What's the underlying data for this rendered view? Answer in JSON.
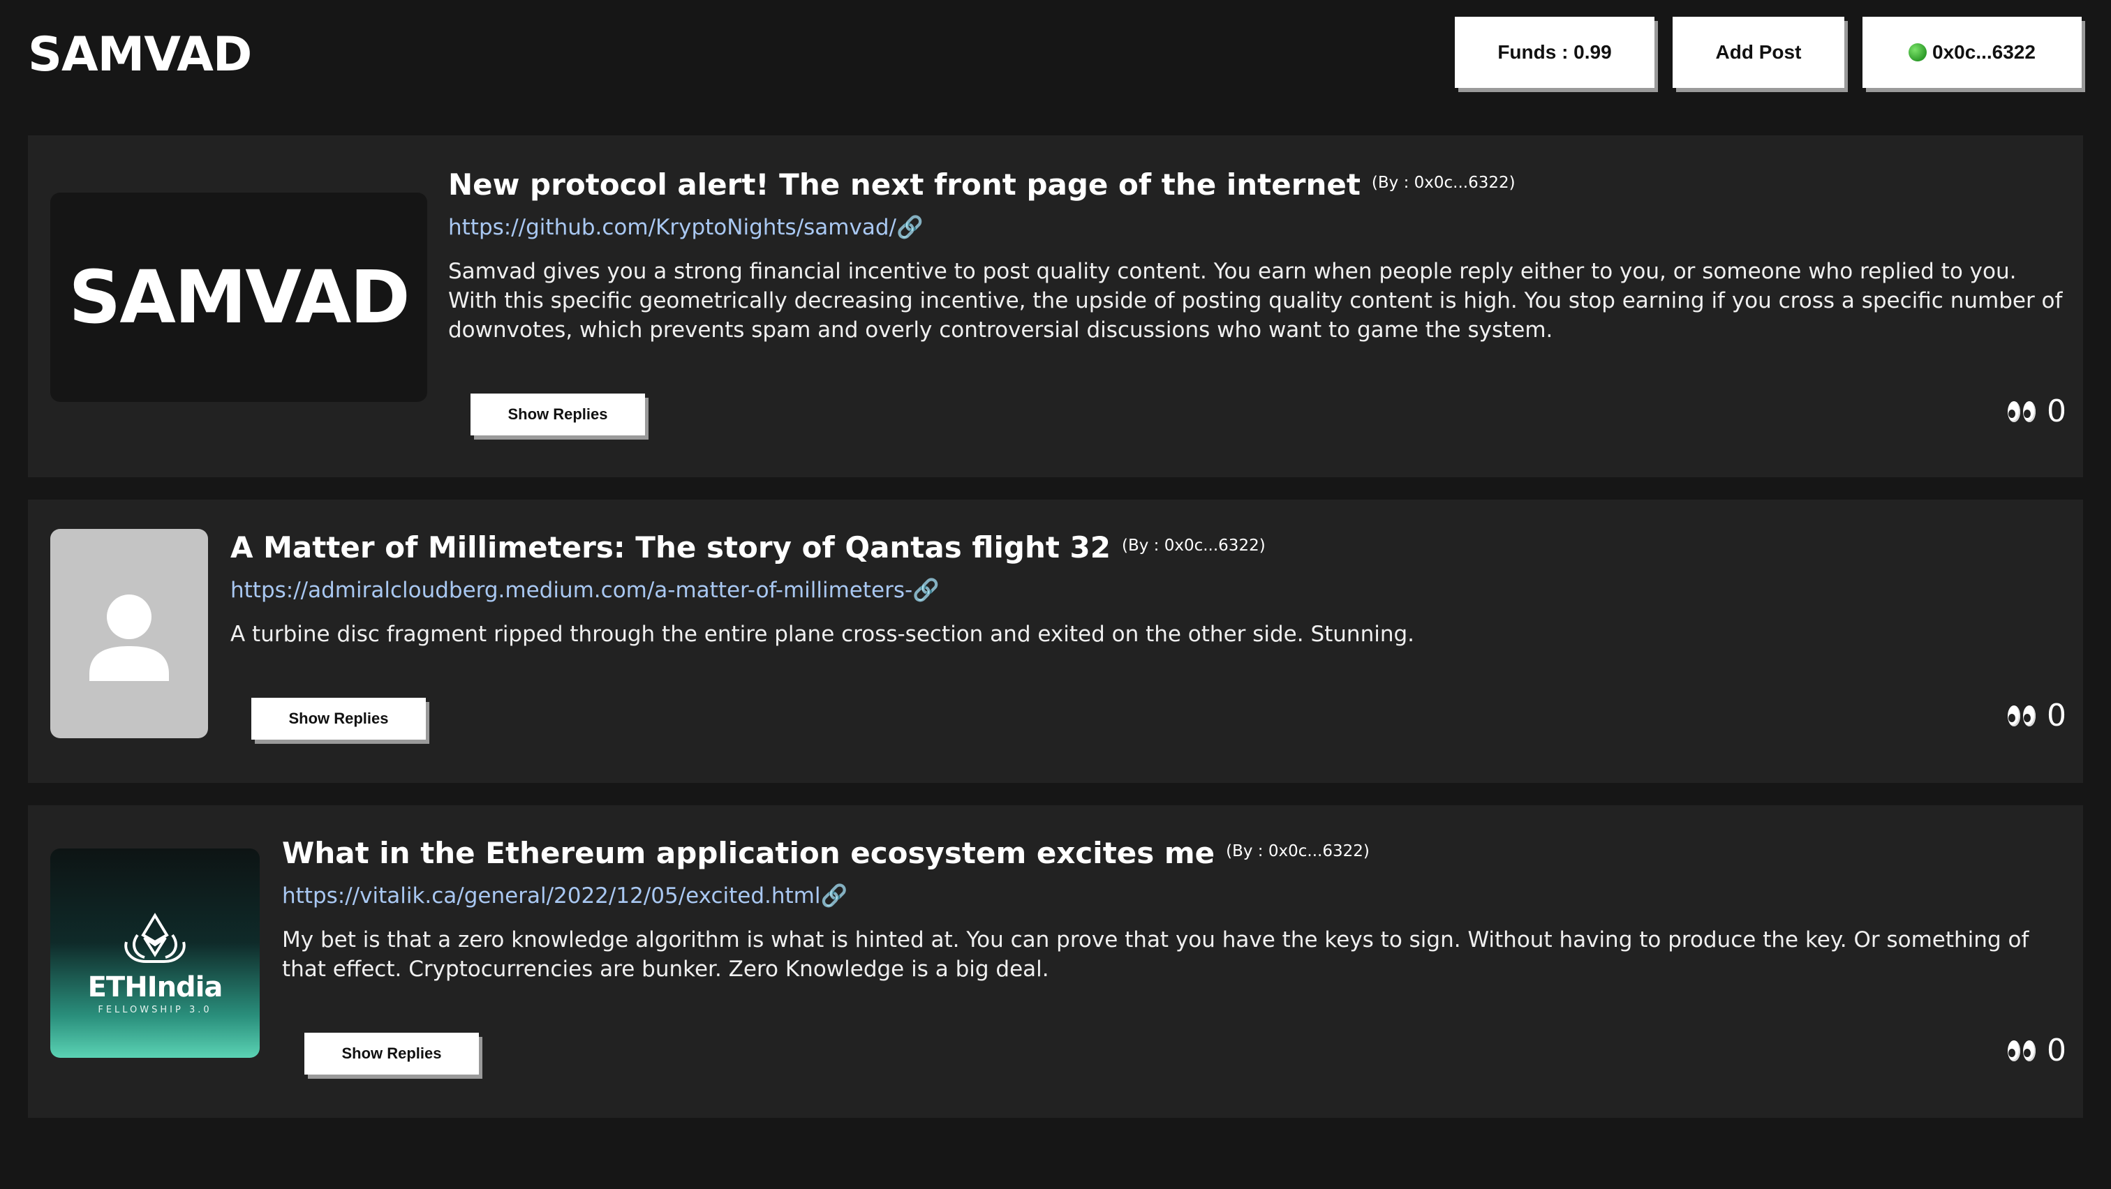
{
  "app": {
    "logo": "SAMVAD"
  },
  "header": {
    "funds_label": "Funds : 0.99",
    "add_post_label": "Add Post",
    "wallet_label": "0x0c...6322",
    "wallet_status_color": "#2e9c2a"
  },
  "posts": [
    {
      "title": "New protocol alert! The next front page of the internet",
      "author": "(By : 0x0c...6322)",
      "link": "https://github.com/KryptoNights/samvad/🔗",
      "body": "Samvad gives you a strong financial incentive to post quality content. You earn when people reply either to you, or someone who replied to you. With this specific geometrically decreasing incentive, the upside of posting quality content is high. You stop earning if you cross a specific number of downvotes, which prevents spam and overly controversial discussions who want to game the system.",
      "thumbnail_text": "SAMVAD",
      "replies_label": "Show Replies",
      "views": "0"
    },
    {
      "title": "A Matter of Millimeters: The story of Qantas flight 32",
      "author": "(By : 0x0c...6322)",
      "link": "https://admiralcloudberg.medium.com/a-matter-of-millimeters-🔗",
      "body": "A turbine disc fragment ripped through the entire plane cross-section and exited on the other side. Stunning.",
      "thumbnail_icon": "person-placeholder-icon",
      "replies_label": "Show Replies",
      "views": "0"
    },
    {
      "title": "What in the Ethereum application ecosystem excites me",
      "author": "(By : 0x0c...6322)",
      "link": "https://vitalik.ca/general/2022/12/05/excited.html🔗",
      "body": "My bet is that a zero knowledge algorithm is what is hinted at. You can prove that you have the keys to sign. Without having to produce the key. Or something of that effect. Cryptocurrencies are bunker. Zero Knowledge is a big deal.",
      "thumbnail_name": "ETHIndia",
      "thumbnail_sub": "FELLOWSHIP 3.0",
      "replies_label": "Show Replies",
      "views": "0"
    }
  ]
}
